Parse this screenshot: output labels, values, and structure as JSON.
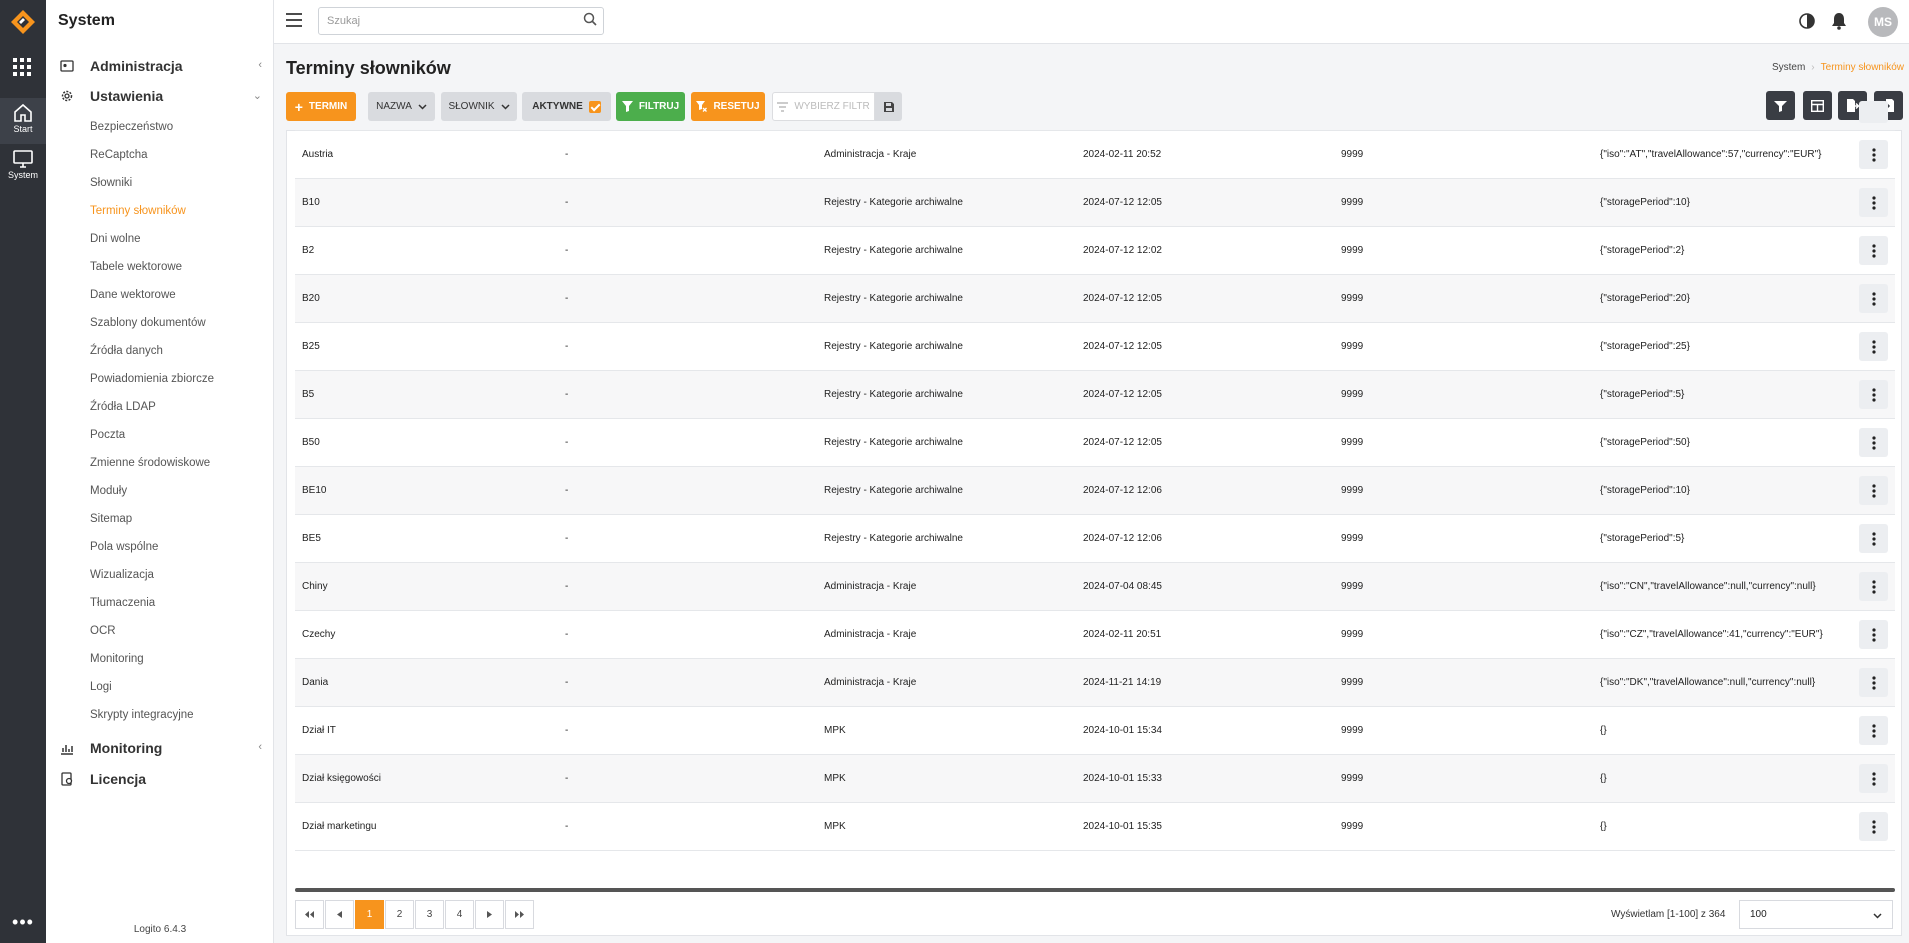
{
  "rail": {
    "start_label": "Start",
    "system_label": "System"
  },
  "sidebar": {
    "title": "System",
    "sections": [
      {
        "label": "Administracja",
        "expanded": false
      },
      {
        "label": "Ustawienia",
        "expanded": true
      },
      {
        "label": "Monitoring",
        "expanded": false
      },
      {
        "label": "Licencja"
      }
    ],
    "items": [
      {
        "label": "Bezpieczeństwo"
      },
      {
        "label": "ReCaptcha"
      },
      {
        "label": "Słowniki"
      },
      {
        "label": "Terminy słowników",
        "active": true
      },
      {
        "label": "Dni wolne"
      },
      {
        "label": "Tabele wektorowe"
      },
      {
        "label": "Dane wektorowe"
      },
      {
        "label": "Szablony dokumentów"
      },
      {
        "label": "Źródła danych"
      },
      {
        "label": "Powiadomienia zbiorcze"
      },
      {
        "label": "Źródła LDAP"
      },
      {
        "label": "Poczta"
      },
      {
        "label": "Zmienne środowiskowe"
      },
      {
        "label": "Moduły"
      },
      {
        "label": "Sitemap"
      },
      {
        "label": "Pola wspólne"
      },
      {
        "label": "Wizualizacja"
      },
      {
        "label": "Tłumaczenia"
      },
      {
        "label": "OCR"
      },
      {
        "label": "Monitoring"
      },
      {
        "label": "Logi"
      },
      {
        "label": "Skrypty integracyjne"
      }
    ],
    "version": "Logito 6.4.3"
  },
  "topbar": {
    "search_placeholder": "Szukaj",
    "avatar_initials": "MS"
  },
  "page": {
    "title": "Terminy słowników",
    "breadcrumb": [
      "System",
      "Terminy słowników"
    ]
  },
  "toolbar": {
    "add_label": "TERMIN",
    "name_filter": "NAZWA",
    "dict_filter": "SŁOWNIK",
    "active_label": "AKTYWNE",
    "filter_label": "FILTRUJ",
    "reset_label": "RESETUJ",
    "choose_filter": "WYBIERZ FILTR"
  },
  "table": {
    "rows": [
      {
        "name": "Austria",
        "desc": "-",
        "dict": "Administracja - Kraje",
        "date": "2024-02-11 20:52",
        "order": "9999",
        "json": "{\"iso\":\"AT\",\"travelAllowance\":57,\"currency\":\"EUR\"}"
      },
      {
        "name": "B10",
        "desc": "-",
        "dict": "Rejestry - Kategorie archiwalne",
        "date": "2024-07-12 12:05",
        "order": "9999",
        "json": "{\"storagePeriod\":10}"
      },
      {
        "name": "B2",
        "desc": "-",
        "dict": "Rejestry - Kategorie archiwalne",
        "date": "2024-07-12 12:02",
        "order": "9999",
        "json": "{\"storagePeriod\":2}"
      },
      {
        "name": "B20",
        "desc": "-",
        "dict": "Rejestry - Kategorie archiwalne",
        "date": "2024-07-12 12:05",
        "order": "9999",
        "json": "{\"storagePeriod\":20}"
      },
      {
        "name": "B25",
        "desc": "-",
        "dict": "Rejestry - Kategorie archiwalne",
        "date": "2024-07-12 12:05",
        "order": "9999",
        "json": "{\"storagePeriod\":25}"
      },
      {
        "name": "B5",
        "desc": "-",
        "dict": "Rejestry - Kategorie archiwalne",
        "date": "2024-07-12 12:05",
        "order": "9999",
        "json": "{\"storagePeriod\":5}"
      },
      {
        "name": "B50",
        "desc": "-",
        "dict": "Rejestry - Kategorie archiwalne",
        "date": "2024-07-12 12:05",
        "order": "9999",
        "json": "{\"storagePeriod\":50}"
      },
      {
        "name": "BE10",
        "desc": "-",
        "dict": "Rejestry - Kategorie archiwalne",
        "date": "2024-07-12 12:06",
        "order": "9999",
        "json": "{\"storagePeriod\":10}"
      },
      {
        "name": "BE5",
        "desc": "-",
        "dict": "Rejestry - Kategorie archiwalne",
        "date": "2024-07-12 12:06",
        "order": "9999",
        "json": "{\"storagePeriod\":5}"
      },
      {
        "name": "Chiny",
        "desc": "-",
        "dict": "Administracja - Kraje",
        "date": "2024-07-04 08:45",
        "order": "9999",
        "json": "{\"iso\":\"CN\",\"travelAllowance\":null,\"currency\":null}"
      },
      {
        "name": "Czechy",
        "desc": "-",
        "dict": "Administracja - Kraje",
        "date": "2024-02-11 20:51",
        "order": "9999",
        "json": "{\"iso\":\"CZ\",\"travelAllowance\":41,\"currency\":\"EUR\"}"
      },
      {
        "name": "Dania",
        "desc": "-",
        "dict": "Administracja - Kraje",
        "date": "2024-11-21 14:19",
        "order": "9999",
        "json": "{\"iso\":\"DK\",\"travelAllowance\":null,\"currency\":null}"
      },
      {
        "name": "Dział IT",
        "desc": "-",
        "dict": "MPK",
        "date": "2024-10-01 15:34",
        "order": "9999",
        "json": "{}"
      },
      {
        "name": "Dział księgowości",
        "desc": "-",
        "dict": "MPK",
        "date": "2024-10-01 15:33",
        "order": "9999",
        "json": "{}"
      },
      {
        "name": "Dział marketingu",
        "desc": "-",
        "dict": "MPK",
        "date": "2024-10-01 15:35",
        "order": "9999",
        "json": "{}"
      }
    ]
  },
  "pagination": {
    "pages": [
      "1",
      "2",
      "3",
      "4"
    ],
    "current": "1",
    "info": "Wyświetlam [1-100] z 364",
    "per_page": "100"
  },
  "colors": {
    "accent": "#f7941d",
    "success": "#4cae4c",
    "rail": "#2f3238"
  }
}
